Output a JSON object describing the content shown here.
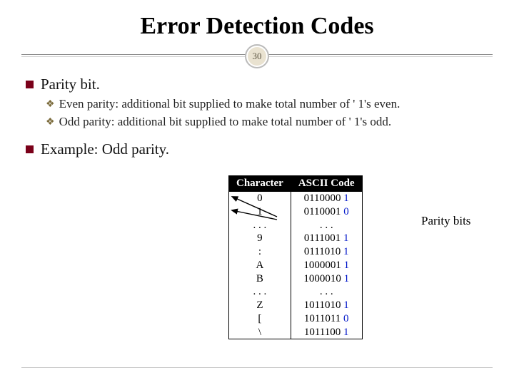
{
  "title": "Error Detection Codes",
  "slide_number": "30",
  "bullets": {
    "b1": "Parity bit.",
    "b1_subs": {
      "s1": "Even parity: additional bit supplied to make total number of ' 1's even.",
      "s2": "Odd parity: additional bit supplied to make total number of ' 1's odd."
    },
    "b2": "Example: Odd parity."
  },
  "table": {
    "headers": {
      "h1": "Character",
      "h2": "ASCII Code"
    },
    "rows": [
      {
        "char": "0",
        "code": "0110000",
        "parity": "1"
      },
      {
        "char": "1",
        "code": "0110001",
        "parity": "0"
      },
      {
        "char": ". . .",
        "code": ". . .",
        "parity": ""
      },
      {
        "char": "9",
        "code": "0111001",
        "parity": "1"
      },
      {
        "char": ":",
        "code": "0111010",
        "parity": "1"
      },
      {
        "char": "A",
        "code": "1000001",
        "parity": "1"
      },
      {
        "char": "B",
        "code": "1000010",
        "parity": "1"
      },
      {
        "char": ". . .",
        "code": ". . .",
        "parity": ""
      },
      {
        "char": "Z",
        "code": "1011010",
        "parity": "1"
      },
      {
        "char": "[",
        "code": "1011011",
        "parity": "0"
      },
      {
        "char": "\\",
        "code": "1011100",
        "parity": "1"
      }
    ]
  },
  "annotation": "Parity bits"
}
